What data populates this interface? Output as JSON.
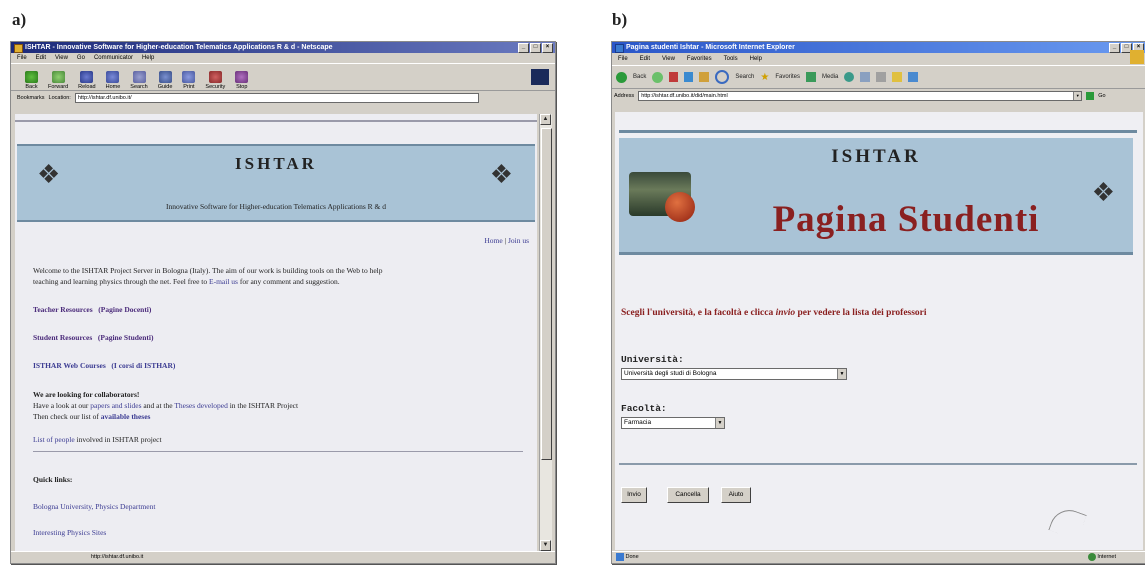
{
  "labels": {
    "a": "a)",
    "b": "b)"
  },
  "netscape": {
    "title": "ISHTAR - Innovative Software for Higher-education Telematics Applications R & d - Netscape",
    "menu": [
      "File",
      "Edit",
      "View",
      "Go",
      "Communicator",
      "Help"
    ],
    "toolbar": [
      "Back",
      "Forward",
      "Reload",
      "Home",
      "Search",
      "Guide",
      "Print",
      "Security",
      "Stop"
    ],
    "bookmarks_label": "Bookmarks",
    "location_label": "Location:",
    "url": "http://ishtar.df.unibo.it/",
    "status_url": "http://ishtar.df.unibo.it",
    "page": {
      "title": "ISHTAR",
      "subtitle": "Innovative Software for Higher-education Telematics Applications R & d",
      "home": "Home",
      "sep": "|",
      "join": "Join us",
      "welcome_1": "Welcome to the ISHTAR Project Server in Bologna (Italy). The aim of our work is building tools on the Web to help",
      "welcome_2a": "teaching and learning physics through the net. Feel free to ",
      "email": "E-mail us",
      "welcome_2b": " for any comment and suggestion.",
      "teacher": "Teacher Resources",
      "teacher_it": "(Pagine Docenti)",
      "student": "Student Resources",
      "student_it": "(Pagine Studenti)",
      "courses": "ISTHAR Web Courses",
      "courses_it": "(I corsi di ISTHAR)",
      "collab_head": "We are looking for collaborators!",
      "collab_1a": "Have a look at our ",
      "papers": "papers and slides",
      "collab_1b": " and at the ",
      "theses_dev": "Theses developed",
      "collab_1c": " in the ISHTAR Project",
      "collab_2a": "Then check our list of ",
      "available": "available theses",
      "people": "List of people",
      "people_rest": " involved in ISHTAR project",
      "quick": "Quick links:",
      "q1": "Bologna University, Physics Department",
      "q2": "Interesting Physics Sites"
    }
  },
  "ie": {
    "title": "Pagina studenti Ishtar - Microsoft Internet Explorer",
    "menu": [
      "File",
      "Edit",
      "View",
      "Favorites",
      "Tools",
      "Help"
    ],
    "back": "Back",
    "search": "Search",
    "favorites": "Favorites",
    "media": "Media",
    "address_label": "Address",
    "url": "http://ishtar.df.unibo.it/did/main.html",
    "go": "Go",
    "status_left": "Done",
    "status_right": "Internet",
    "page": {
      "title": "ISHTAR",
      "heading": "Pagina Studenti",
      "instr_a": "Scegli l'università, e la facoltà e clicca ",
      "instr_em": "invio",
      "instr_b": " per vedere la lista dei professori",
      "uni_label": "Università:",
      "uni_value": "Università degli studi di Bologna",
      "fac_label": "Facoltà:",
      "fac_value": "Farmacia",
      "btn_invio": "Invio",
      "btn_cancella": "Cancella",
      "btn_aiuto": "Aiuto"
    }
  }
}
